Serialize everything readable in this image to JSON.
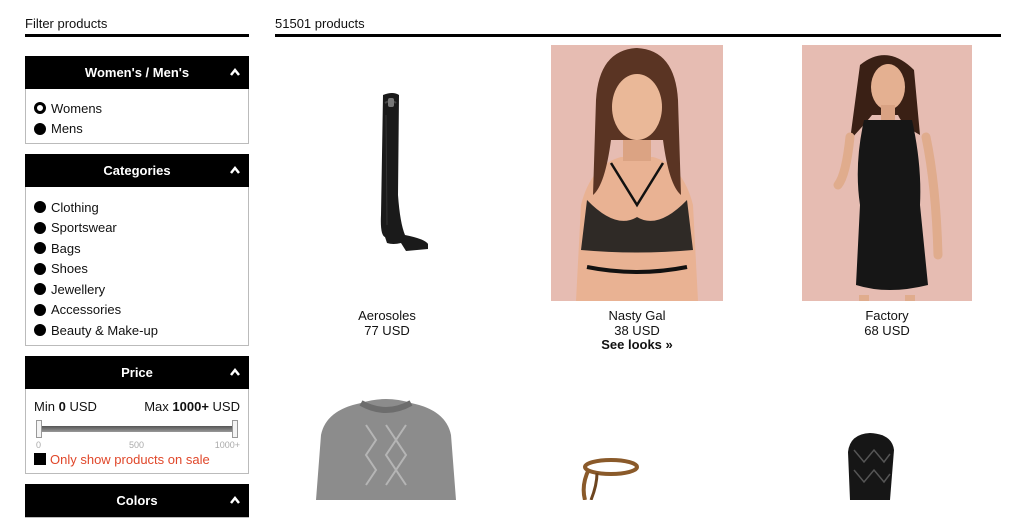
{
  "sidebar": {
    "title": "Filter products",
    "gender": {
      "title": "Women's / Men's",
      "options": [
        "Womens",
        "Mens"
      ],
      "selected": "Womens"
    },
    "categories": {
      "title": "Categories",
      "options": [
        "Clothing",
        "Sportswear",
        "Bags",
        "Shoes",
        "Jewellery",
        "Accessories",
        "Beauty & Make-up"
      ]
    },
    "price": {
      "title": "Price",
      "min_label": "Min",
      "min_value": "0",
      "min_unit": "USD",
      "max_label": "Max",
      "max_value": "1000+",
      "max_unit": "USD",
      "ticks": [
        "0",
        "500",
        "1000+"
      ],
      "sale_label": "Only show products on sale"
    },
    "colors": {
      "title": "Colors"
    }
  },
  "main": {
    "count_label": "51501 products",
    "products": [
      {
        "brand": "Aerosoles",
        "price": "77 USD",
        "link": ""
      },
      {
        "brand": "Nasty Gal",
        "price": "38 USD",
        "link": "See looks »"
      },
      {
        "brand": "Factory",
        "price": "68 USD",
        "link": ""
      }
    ]
  },
  "colors": {
    "accent": "#000000",
    "sale": "#e0472a",
    "photo_bg": "#e6bcb2"
  }
}
